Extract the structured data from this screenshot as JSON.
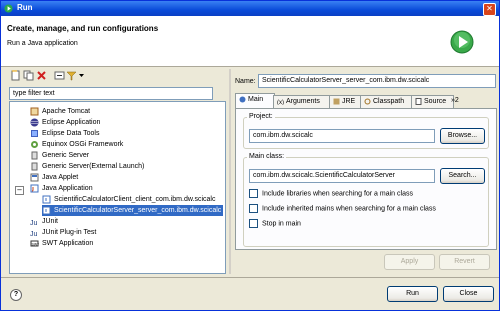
{
  "window": {
    "title": "Run",
    "close_glyph": "✕"
  },
  "header": {
    "title": "Create, manage, and run configurations",
    "subtitle": "Run a Java application"
  },
  "left": {
    "filter_value": "type filter text",
    "tree": [
      {
        "label": "Apache Tomcat",
        "icon": "tomcat-icon"
      },
      {
        "label": "Eclipse Application",
        "icon": "eclipse-icon"
      },
      {
        "label": "Eclipse Data Tools",
        "icon": "datatools-icon"
      },
      {
        "label": "Equinox OSGi Framework",
        "icon": "osgi-icon"
      },
      {
        "label": "Generic Server",
        "icon": "server-icon"
      },
      {
        "label": "Generic Server(External Launch)",
        "icon": "server-icon"
      },
      {
        "label": "Java Applet",
        "icon": "applet-icon"
      },
      {
        "label": "Java Application",
        "icon": "java-app-icon"
      },
      {
        "label": "ScientificCalculatorClient_client_com.ibm.dw.scicalc",
        "icon": "java-config-icon"
      },
      {
        "label": "ScientificCalculatorServer_server_com.ibm.dw.scicalc",
        "icon": "java-config-icon"
      },
      {
        "label": "JUnit",
        "icon": "junit-icon"
      },
      {
        "label": "JUnit Plug-in Test",
        "icon": "junit-plugin-icon"
      },
      {
        "label": "SWT Application",
        "icon": "swt-icon"
      }
    ],
    "expander_minus": "−"
  },
  "right": {
    "name_label": "Name:",
    "name_value": "ScientificCalculatorServer_server_com.ibm.dw.scicalc",
    "tabs": [
      "Main",
      "Arguments",
      "JRE",
      "Classpath",
      "Source",
      "»2"
    ],
    "project_label": "Project:",
    "project_value": "com.ibm.dw.scicalc",
    "browse_label": "Browse...",
    "main_class_label": "Main class:",
    "main_class_value": "com.ibm.dw.scicalc.ScientificCalculatorServer",
    "search_label": "Search...",
    "checkboxes": [
      "Include libraries when searching for a main class",
      "Include inherited mains when searching for a main class",
      "Stop in main"
    ],
    "apply_label": "Apply",
    "revert_label": "Revert"
  },
  "footer": {
    "help_glyph": "?",
    "run_label": "Run",
    "close_label": "Close"
  }
}
